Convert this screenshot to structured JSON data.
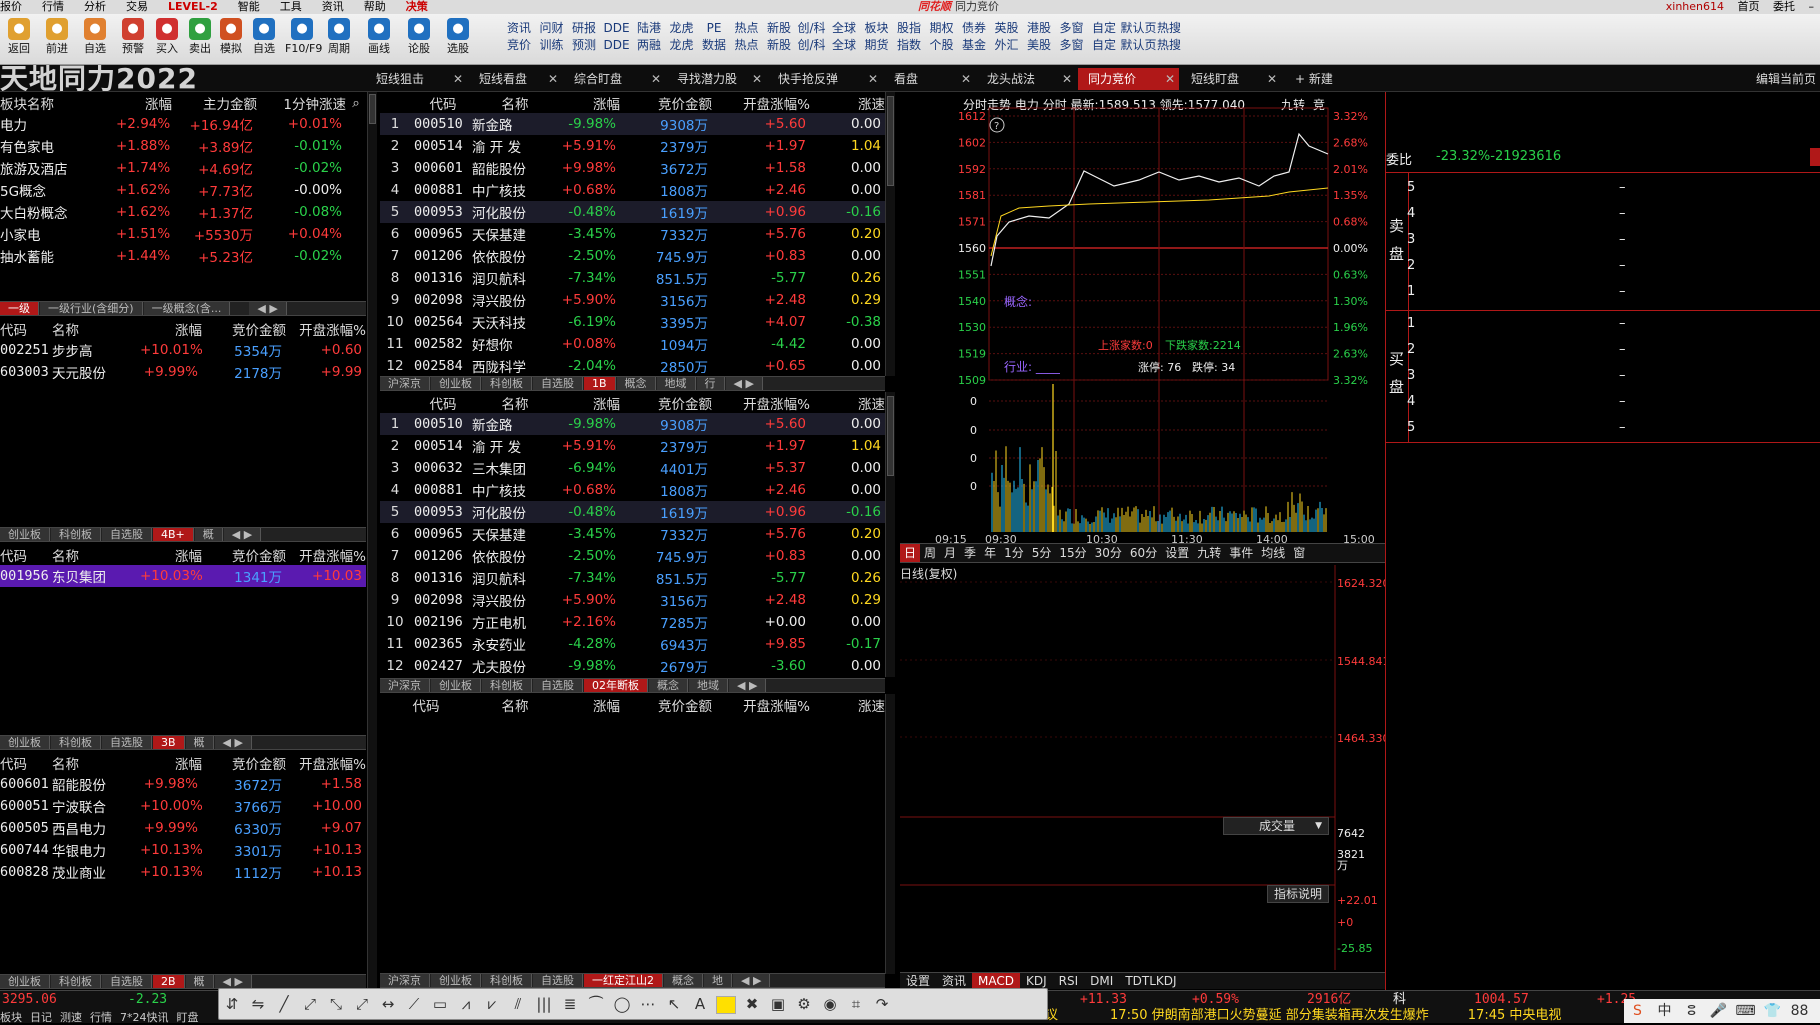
{
  "menu": [
    "报价",
    "行情",
    "分析",
    "交易",
    "LEVEL-2",
    "智能",
    "工具",
    "资讯",
    "帮助",
    "决策"
  ],
  "app_title": {
    "brand": "同花顺",
    "title": "同力竞价"
  },
  "user": {
    "name": "xinhen614",
    "btn1": "首页",
    "btn2": "委托",
    "min": "–"
  },
  "toolbar": [
    {
      "label": "返回",
      "icon": "back-icon",
      "color": "#e0a030"
    },
    {
      "label": "前进",
      "icon": "forward-icon",
      "color": "#e0a030"
    },
    {
      "label": "自选",
      "icon": "star-icon",
      "color": "#e08030"
    },
    {
      "label": "预警",
      "icon": "clock-icon",
      "color": "#d04030"
    },
    {
      "label": "买入",
      "icon": "buy-icon",
      "color": "#d03030"
    },
    {
      "label": "卖出",
      "icon": "sell-icon",
      "color": "#30a040"
    },
    {
      "label": "模拟",
      "icon": "sim-icon",
      "color": "#d05020"
    },
    {
      "label": "自选",
      "icon": "add-fav-icon",
      "color": "#2070c0"
    },
    {
      "label": "F10/F9",
      "icon": "f10-icon",
      "color": "#2070c0"
    },
    {
      "label": "周期",
      "icon": "cycle-icon",
      "color": "#2070c0"
    },
    {
      "label": "画线",
      "icon": "draw-icon",
      "color": "#2070c0"
    },
    {
      "label": "论股",
      "icon": "forum-icon",
      "color": "#2070c0"
    },
    {
      "label": "选股",
      "icon": "pick-icon",
      "color": "#2070c0"
    }
  ],
  "toolbar2": [
    {
      "top": "资讯",
      "bottom": "竞价"
    },
    {
      "top": "问财",
      "bottom": "训练"
    },
    {
      "top": "研报",
      "bottom": "预测"
    },
    {
      "top": "DDE",
      "bottom": "DDE"
    },
    {
      "top": "陆港",
      "bottom": "两融"
    },
    {
      "top": "龙虎",
      "bottom": "龙虎"
    },
    {
      "top": "PE",
      "bottom": "数据"
    },
    {
      "top": "热点",
      "bottom": "热点"
    },
    {
      "top": "新股",
      "bottom": "新股"
    },
    {
      "top": "创/科",
      "bottom": "创/科"
    },
    {
      "top": "全球",
      "bottom": "全球"
    },
    {
      "top": "板块",
      "bottom": "期货"
    },
    {
      "top": "股指",
      "bottom": "指数"
    },
    {
      "top": "期权",
      "bottom": "个股"
    },
    {
      "top": "债券",
      "bottom": "基金"
    },
    {
      "top": "英股",
      "bottom": "外汇"
    },
    {
      "top": "港股",
      "bottom": "美股"
    },
    {
      "top": "多窗",
      "bottom": "多窗"
    },
    {
      "top": "自定",
      "bottom": "自定"
    },
    {
      "top": "默认页",
      "bottom": "默认页"
    },
    {
      "top": "热搜",
      "bottom": "热搜"
    }
  ],
  "watermark": "天地同力2022",
  "tabs": [
    "短线狙击",
    "短线看盘",
    "综合盯盘",
    "寻找潜力股",
    "快手抢反弹",
    "看盘",
    "龙头战法",
    "同力竞价",
    "短线盯盘"
  ],
  "active_tab": "同力竞价",
  "new_tab": "新建",
  "edit_now": "编辑当前页",
  "sector": {
    "headers": [
      "板块名称",
      "涨幅",
      "主力金额",
      "1分钟涨速"
    ],
    "rows": [
      [
        "电力",
        "+2.94%",
        "+16.94亿",
        "+0.01%"
      ],
      [
        "有色家电",
        "+1.88%",
        "+3.89亿",
        "-0.01%"
      ],
      [
        "旅游及酒店",
        "+1.74%",
        "+4.69亿",
        "-0.02%"
      ],
      [
        "5G概念",
        "+1.62%",
        "+7.73亿",
        "-0.00%"
      ],
      [
        "大白粉概念",
        "+1.62%",
        "+1.37亿",
        "-0.08%"
      ],
      [
        "小家电",
        "+1.51%",
        "+5530万",
        "+0.04%"
      ],
      [
        "抽水蓄能",
        "+1.44%",
        "+5.23亿",
        "-0.02%"
      ]
    ],
    "subtabs": [
      "一级",
      "一级行业(含细分)",
      "一级概念(含...",
      ""
    ]
  },
  "lp1": {
    "headers": [
      "代码",
      "名称",
      "涨幅",
      "竞价金额",
      "开盘涨幅%"
    ],
    "rows": [
      [
        "002251",
        "步步高",
        "+10.01%",
        "5354万",
        "+0.60"
      ],
      [
        "603003",
        "天元股份",
        "+9.99%",
        "2178万",
        "+9.99"
      ]
    ],
    "subtabs": [
      "创业板",
      "科创板",
      "自选股",
      "4B+",
      "概"
    ]
  },
  "lp2": {
    "headers": [
      "代码",
      "名称",
      "涨幅",
      "竞价金额",
      "开盘涨幅%"
    ],
    "rows": [
      [
        "001956",
        "东贝集团",
        "+10.03%",
        "1341万",
        "+10.03"
      ]
    ],
    "subtabs": [
      "创业板",
      "科创板",
      "自选股",
      "3B",
      "概"
    ]
  },
  "lp3": {
    "headers": [
      "代码",
      "名称",
      "涨幅",
      "竞价金额",
      "开盘涨幅%"
    ],
    "rows": [
      [
        "600601",
        "韶能股份",
        "+9.98%",
        "3672万",
        "+1.58"
      ],
      [
        "600051",
        "宁波联合",
        "+10.00%",
        "3766万",
        "+10.00"
      ],
      [
        "600505",
        "西昌电力",
        "+9.99%",
        "6330万",
        "+9.07"
      ],
      [
        "600744",
        "华银电力",
        "+10.13%",
        "3301万",
        "+10.13"
      ],
      [
        "600828",
        "茂业商业",
        "+10.13%",
        "1112万",
        "+10.13"
      ]
    ],
    "subtabs": [
      "创业板",
      "科创板",
      "自选股",
      "2B",
      "概"
    ]
  },
  "mp1": {
    "headers": [
      "",
      "代码",
      "名称",
      "涨幅",
      "竞价金额",
      "开盘涨幅%",
      "涨速"
    ],
    "rows": [
      [
        "1",
        "000510",
        "新金路",
        "-9.98%",
        "9308万",
        "+5.60",
        "0.00"
      ],
      [
        "2",
        "000514",
        "渝 开 发",
        "+5.91%",
        "2379万",
        "+1.97",
        "1.04"
      ],
      [
        "3",
        "000601",
        "韶能股份",
        "+9.98%",
        "3672万",
        "+1.58",
        "0.00"
      ],
      [
        "4",
        "000881",
        "中广核技",
        "+0.68%",
        "1808万",
        "+2.46",
        "0.00"
      ],
      [
        "5",
        "000953",
        "河化股份",
        "-0.48%",
        "1619万",
        "+0.96",
        "-0.16"
      ],
      [
        "6",
        "000965",
        "天保基建",
        "-3.45%",
        "7332万",
        "+5.76",
        "0.20"
      ],
      [
        "7",
        "001206",
        "依依股份",
        "-2.50%",
        "745.9万",
        "+0.83",
        "0.00"
      ],
      [
        "8",
        "001316",
        "润贝航科",
        "-7.34%",
        "851.5万",
        "-5.77",
        "0.26"
      ],
      [
        "9",
        "002098",
        "浔兴股份",
        "+5.90%",
        "3156万",
        "+2.48",
        "0.29"
      ],
      [
        "10",
        "002564",
        "天沃科技",
        "-6.19%",
        "3395万",
        "+4.07",
        "-0.38"
      ],
      [
        "11",
        "002582",
        "好想你",
        "+0.08%",
        "1094万",
        "-4.42",
        "0.00"
      ],
      [
        "12",
        "002584",
        "西陇科学",
        "-2.04%",
        "2850万",
        "+0.65",
        "0.00"
      ]
    ],
    "subtabs": [
      "沪深京",
      "创业板",
      "科创板",
      "自选股",
      "1B",
      "概念",
      "地域",
      "行"
    ]
  },
  "mp2": {
    "headers": [
      "",
      "代码",
      "名称",
      "涨幅",
      "竞价金额",
      "开盘涨幅%",
      "涨速"
    ],
    "rows": [
      [
        "1",
        "000510",
        "新金路",
        "-9.98%",
        "9308万",
        "+5.60",
        "0.00"
      ],
      [
        "2",
        "000514",
        "渝 开 发",
        "+5.91%",
        "2379万",
        "+1.97",
        "1.04"
      ],
      [
        "3",
        "000632",
        "三木集团",
        "-6.94%",
        "4401万",
        "+5.37",
        "0.00"
      ],
      [
        "4",
        "000881",
        "中广核技",
        "+0.68%",
        "1808万",
        "+2.46",
        "0.00"
      ],
      [
        "5",
        "000953",
        "河化股份",
        "-0.48%",
        "1619万",
        "+0.96",
        "-0.16"
      ],
      [
        "6",
        "000965",
        "天保基建",
        "-3.45%",
        "7332万",
        "+5.76",
        "0.20"
      ],
      [
        "7",
        "001206",
        "依依股份",
        "-2.50%",
        "745.9万",
        "+0.83",
        "0.00"
      ],
      [
        "8",
        "001316",
        "润贝航科",
        "-7.34%",
        "851.5万",
        "-5.77",
        "0.26"
      ],
      [
        "9",
        "002098",
        "浔兴股份",
        "+5.90%",
        "3156万",
        "+2.48",
        "0.29"
      ],
      [
        "10",
        "002196",
        "方正电机",
        "+2.16%",
        "7285万",
        "+0.00",
        "0.00"
      ],
      [
        "11",
        "002365",
        "永安药业",
        "-4.28%",
        "6943万",
        "+9.85",
        "-0.17"
      ],
      [
        "12",
        "002427",
        "尤夫股份",
        "-9.98%",
        "2679万",
        "-3.60",
        "0.00"
      ]
    ],
    "subtabs": [
      "沪深京",
      "创业板",
      "科创板",
      "自选股",
      "02年断板",
      "概念",
      "地域"
    ]
  },
  "mp3": {
    "headers": [
      "代码",
      "名称",
      "涨幅",
      "竞价金额",
      "开盘涨幅%",
      "涨速"
    ],
    "subtabs": [
      "沪深京",
      "创业板",
      "科创板",
      "自选股",
      "一红定江山2",
      "概念",
      "地"
    ]
  },
  "intraday": {
    "header_label": "分时走势",
    "stock": "电力",
    "period": "分时",
    "last_label": "最新:",
    "last": "1589.513",
    "lead_label": "领先:",
    "lead": "1577.040",
    "nine_turn": "九转",
    "bid": "竞",
    "price_ticks": [
      "1612",
      "1602",
      "1592",
      "1581",
      "1571",
      "1560",
      "1551",
      "1540",
      "1530",
      "1519",
      "1509"
    ],
    "pct_right": [
      "3.32%",
      "2.68%",
      "2.01%",
      "1.35%",
      "0.68%",
      "0.00%",
      "0.63%",
      "1.30%",
      "1.96%",
      "2.63%",
      "3.32%"
    ],
    "vol_ticks": [
      "0",
      "0",
      "0",
      "0"
    ],
    "time_ticks": [
      "09:15",
      "09:30",
      "10:30",
      "11:30",
      "14:00",
      "15:00"
    ],
    "concept_label": "概念:",
    "industry_label": "行业:",
    "industry_value": "____",
    "up_label": "上涨家数:",
    "up_count": "0",
    "down_label": "下跌家数:",
    "down_count": "2214",
    "limit_up_label": "涨停:",
    "limit_up": "76",
    "limit_down_label": "跌停:",
    "limit_down": "34",
    "help": "?"
  },
  "period_bar": [
    "日",
    "周",
    "月",
    "季",
    "年",
    "1分",
    "5分",
    "15分",
    "30分",
    "60分",
    "设置",
    "九转",
    "事件",
    "均线",
    "窗"
  ],
  "kline": {
    "title": "日线(复权)",
    "price_ticks": [
      "1624.320",
      "1544.841",
      "1464.330"
    ],
    "vol_label": "成交量",
    "vol_ticks": [
      "7642",
      "3821",
      "万"
    ],
    "ind_label": "指标说明",
    "macd_ticks": [
      "+22.01",
      "+0",
      "-25.85"
    ]
  },
  "bottom_tabs": [
    "设置",
    "资讯",
    "MACD",
    "KDJ",
    "RSI",
    "DMI",
    "TDTLKDJ"
  ],
  "order_book": {
    "ratio_label": "委比",
    "ratio": "-23.32%",
    "ratio_diff": "-21923616",
    "sell_label": "卖盘",
    "buy_label": "买盘",
    "sell_levels": [
      "5",
      "4",
      "3",
      "2",
      "1"
    ],
    "buy_levels": [
      "1",
      "2",
      "3",
      "4",
      "5"
    ],
    "dash": "–"
  },
  "status": {
    "sh": "3295.06",
    "sh_chg": "-2.23",
    "mid_chg": "+11.33",
    "mid_pct": "+0.59%",
    "amount": "2916亿",
    "kc_label": "科",
    "kc": "1004.57",
    "kc_chg": "+1.25"
  },
  "status2": [
    "板块",
    "日记",
    "测速",
    "行情",
    "7*24快讯",
    "盯盘"
  ],
  "news": [
    "议",
    "17:50 伊朗南部港口火势蔓延 部分集装箱再次发生爆炸",
    "17:45 中央电视"
  ],
  "tray": [
    "S",
    "中",
    "ⵓ",
    "🎤",
    "⌨",
    "👕",
    "88"
  ],
  "draw_tools": [
    "⇵",
    "⇋",
    "╱",
    "⤢",
    "⤡",
    "⤢",
    "↔",
    "⟋",
    "▭",
    "⩘",
    "⩗",
    "⫽",
    "|||",
    "≣",
    "⏜",
    "◯",
    "⋯",
    "↖",
    "A",
    "",
    "✖",
    "▣",
    "⚙",
    "◉",
    "⌗",
    "↷"
  ]
}
